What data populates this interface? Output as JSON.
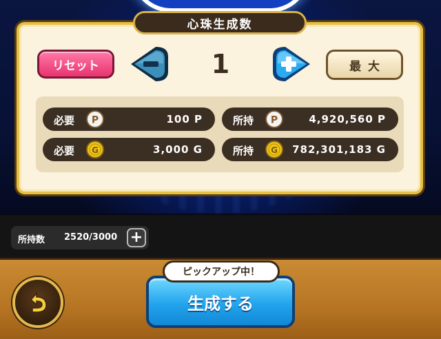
{
  "panel": {
    "title": "心珠生成数",
    "reset_label": "リセット",
    "quantity": "1",
    "max_label": "最大"
  },
  "costs": {
    "required_label": "必要",
    "owned_label": "所持",
    "required_points": "100 P",
    "owned_points": "4,920,560 P",
    "required_gold": "3,000 G",
    "owned_gold": "782,301,183 G",
    "point_icon": "P",
    "gold_icon": "G"
  },
  "inventory": {
    "label": "所持数",
    "value": "2520/3000"
  },
  "footer": {
    "pickup_badge": "ピックアップ中！",
    "create_label": "生成する"
  },
  "colors": {
    "panel_bg": "#fbf3dd",
    "reset_pink": "#e8336f",
    "arrow_blue": "#22a4ec",
    "create_blue": "#1288d6",
    "gold_border": "#e7c043"
  },
  "icons": {
    "minus": "minus-arrow-icon",
    "plus": "plus-arrow-icon",
    "back": "back-arrow-icon",
    "point_coin": "point-coin-icon",
    "gold_coin": "gold-coin-icon",
    "add": "plus-icon"
  }
}
